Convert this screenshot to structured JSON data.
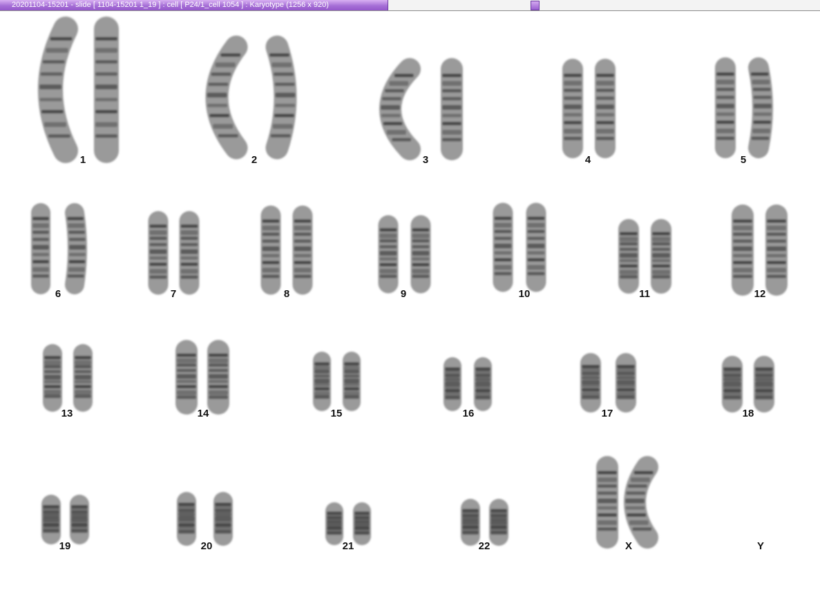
{
  "window": {
    "title": "20201104-15201 - slide [ 1104-15201 1_19 ] : cell [ P24/1_cell 1054 ] : Karyotype  (1256 x 920)"
  },
  "karyotype": {
    "labels": [
      "1",
      "2",
      "3",
      "4",
      "5",
      "6",
      "7",
      "8",
      "9",
      "10",
      "11",
      "12",
      "13",
      "14",
      "15",
      "16",
      "17",
      "18",
      "19",
      "20",
      "21",
      "22",
      "X",
      "Y"
    ]
  }
}
